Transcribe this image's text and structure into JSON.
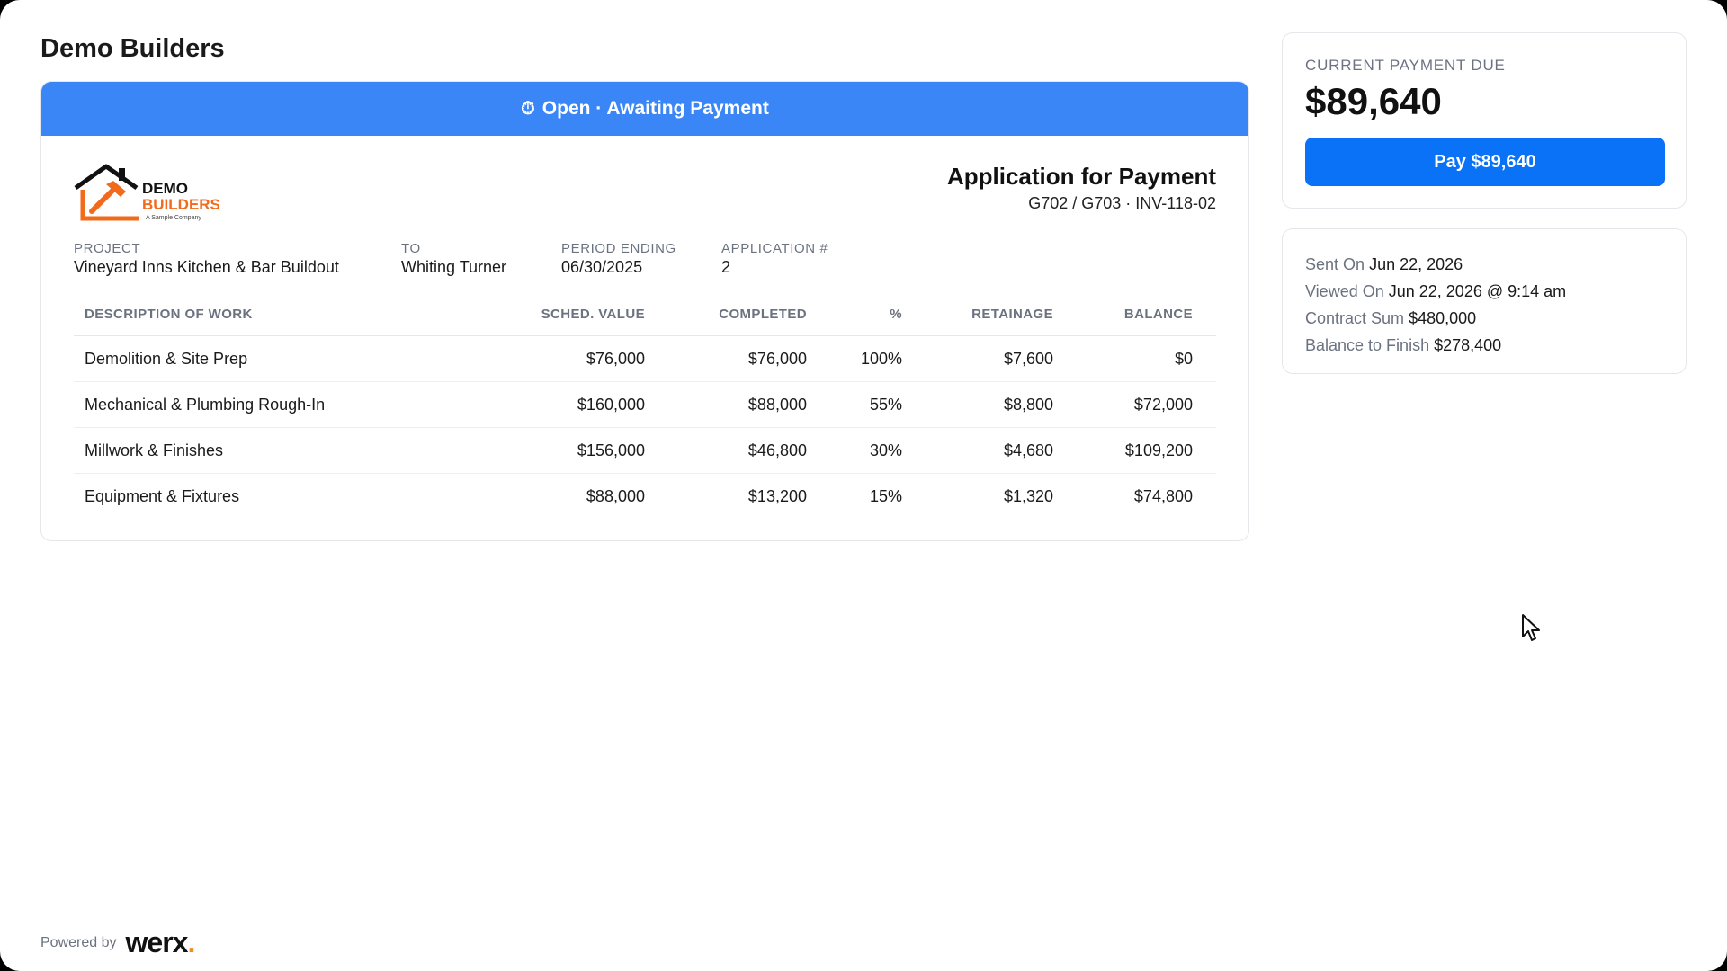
{
  "company": {
    "name": "Demo Builders"
  },
  "status": {
    "icon": "stopwatch-icon",
    "text": "Open · Awaiting Payment",
    "color": "#3b86f7"
  },
  "logo": {
    "line1": "DEMO",
    "line2": "BUILDERS",
    "tagline": "A Sample Company",
    "accent": "#f26a1b"
  },
  "document": {
    "title": "Application for Payment",
    "subtitle": "G702 / G703 · INV-118-02"
  },
  "meta": {
    "project_label": "PROJECT",
    "project_value": "Vineyard Inns Kitchen & Bar Buildout",
    "to_label": "TO",
    "to_value": "Whiting Turner",
    "period_label": "PERIOD ENDING",
    "period_value": "06/30/2025",
    "app_label": "APPLICATION #",
    "app_value": "2"
  },
  "table": {
    "headers": {
      "desc": "DESCRIPTION OF WORK",
      "sched": "SCHED. VALUE",
      "comp": "COMPLETED",
      "pct": "%",
      "ret": "RETAINAGE",
      "bal": "BALANCE"
    },
    "rows": [
      {
        "desc": "Demolition & Site Prep",
        "sched": "$76,000",
        "comp": "$76,000",
        "pct": "100%",
        "ret": "$7,600",
        "bal": "$0"
      },
      {
        "desc": "Mechanical & Plumbing Rough-In",
        "sched": "$160,000",
        "comp": "$88,000",
        "pct": "55%",
        "ret": "$8,800",
        "bal": "$72,000"
      },
      {
        "desc": "Millwork & Finishes",
        "sched": "$156,000",
        "comp": "$46,800",
        "pct": "30%",
        "ret": "$4,680",
        "bal": "$109,200"
      },
      {
        "desc": "Equipment & Fixtures",
        "sched": "$88,000",
        "comp": "$13,200",
        "pct": "15%",
        "ret": "$1,320",
        "bal": "$74,800"
      }
    ]
  },
  "payment": {
    "label": "CURRENT PAYMENT DUE",
    "amount": "$89,640",
    "button_label": "Pay $89,640",
    "button_color": "#0a72f6"
  },
  "info": {
    "sent_label": "Sent On",
    "sent_value": "Jun 22, 2026",
    "viewed_label": "Viewed On",
    "viewed_value": "Jun 22, 2026 @ 9:14 am",
    "contract_label": "Contract Sum",
    "contract_value": "$480,000",
    "balance_label": "Balance to Finish",
    "balance_value": "$278,400"
  },
  "footer": {
    "powered_by": "Powered by",
    "brand": "werx",
    "brand_dot": "."
  }
}
